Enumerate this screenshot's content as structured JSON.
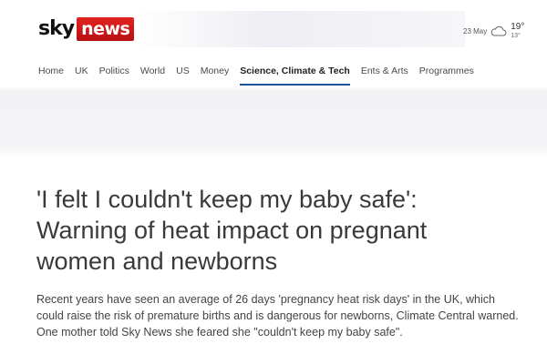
{
  "brand": {
    "sky": "sky",
    "news": "news",
    "sky_color": "#111111",
    "news_bg": "#d11a1a"
  },
  "weather": {
    "date": "23 May",
    "icon": "cloud-icon",
    "high": "19°",
    "low": "13°"
  },
  "nav": {
    "items": [
      {
        "label": "Home"
      },
      {
        "label": "UK"
      },
      {
        "label": "Politics"
      },
      {
        "label": "World"
      },
      {
        "label": "US"
      },
      {
        "label": "Money"
      },
      {
        "label": "Science, Climate & Tech",
        "active": true
      },
      {
        "label": "Ents & Arts"
      },
      {
        "label": "Programmes"
      }
    ],
    "active_underline_color": "#1c4f9c"
  },
  "article": {
    "headline": "'I felt I couldn't keep my baby safe': Warning of heat impact on pregnant women and newborns",
    "standfirst": "Recent years have seen an average of 26 days 'pregnancy heat risk days' in the UK, which could raise the risk of premature births and is dangerous for newborns, Climate Central warned. One mother told Sky News she feared she \"couldn't keep my baby safe\"."
  }
}
